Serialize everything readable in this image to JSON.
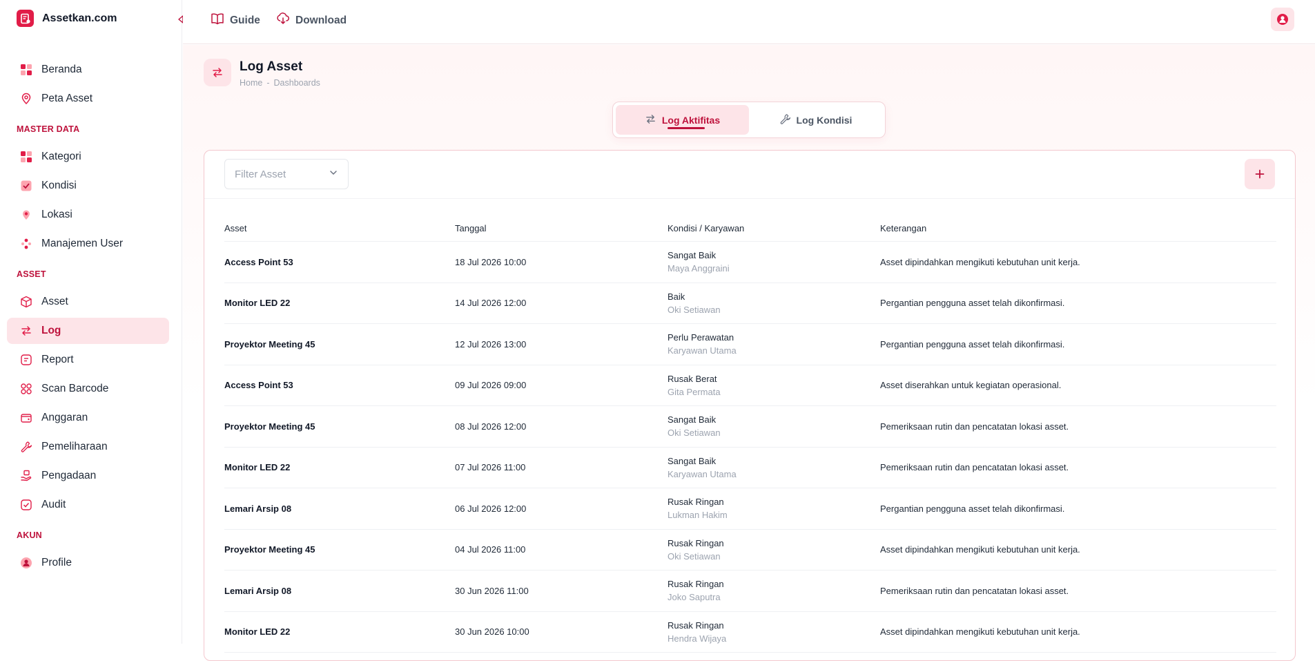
{
  "brand": {
    "name": "Assetkan.com"
  },
  "topbar": {
    "guide": "Guide",
    "download": "Download"
  },
  "sidebar": {
    "top_items": [
      {
        "label": "Beranda"
      },
      {
        "label": "Peta Asset"
      }
    ],
    "sections": [
      {
        "title": "MASTER DATA",
        "items": [
          "Kategori",
          "Kondisi",
          "Lokasi",
          "Manajemen User"
        ]
      },
      {
        "title": "ASSET",
        "items": [
          "Asset",
          "Log",
          "Report",
          "Scan Barcode",
          "Anggaran",
          "Pemeliharaan",
          "Pengadaan",
          "Audit"
        ]
      },
      {
        "title": "AKUN",
        "items": [
          "Profile"
        ]
      }
    ],
    "active_item": "Log"
  },
  "page": {
    "title": "Log Asset",
    "breadcrumb": [
      "Home",
      "-",
      "Dashboards"
    ]
  },
  "tabs": [
    {
      "label": "Log Aktifitas",
      "active": true
    },
    {
      "label": "Log Kondisi",
      "active": false
    }
  ],
  "filter": {
    "placeholder": "Filter Asset"
  },
  "table": {
    "columns": [
      "Asset",
      "Tanggal",
      "Kondisi / Karyawan",
      "Keterangan"
    ],
    "rows": [
      {
        "asset": "Access Point 53",
        "tanggal": "18 Jul 2026 10:00",
        "kondisi": "Sangat Baik",
        "karyawan": "Maya Anggraini",
        "keterangan": "Asset dipindahkan mengikuti kebutuhan unit kerja."
      },
      {
        "asset": "Monitor LED 22",
        "tanggal": "14 Jul 2026 12:00",
        "kondisi": "Baik",
        "karyawan": "Oki Setiawan",
        "keterangan": "Pergantian pengguna asset telah dikonfirmasi."
      },
      {
        "asset": "Proyektor Meeting 45",
        "tanggal": "12 Jul 2026 13:00",
        "kondisi": "Perlu Perawatan",
        "karyawan": "Karyawan Utama",
        "keterangan": "Pergantian pengguna asset telah dikonfirmasi."
      },
      {
        "asset": "Access Point 53",
        "tanggal": "09 Jul 2026 09:00",
        "kondisi": "Rusak Berat",
        "karyawan": "Gita Permata",
        "keterangan": "Asset diserahkan untuk kegiatan operasional."
      },
      {
        "asset": "Proyektor Meeting 45",
        "tanggal": "08 Jul 2026 12:00",
        "kondisi": "Sangat Baik",
        "karyawan": "Oki Setiawan",
        "keterangan": "Pemeriksaan rutin dan pencatatan lokasi asset."
      },
      {
        "asset": "Monitor LED 22",
        "tanggal": "07 Jul 2026 11:00",
        "kondisi": "Sangat Baik",
        "karyawan": "Karyawan Utama",
        "keterangan": "Pemeriksaan rutin dan pencatatan lokasi asset."
      },
      {
        "asset": "Lemari Arsip 08",
        "tanggal": "06 Jul 2026 12:00",
        "kondisi": "Rusak Ringan",
        "karyawan": "Lukman Hakim",
        "keterangan": "Pergantian pengguna asset telah dikonfirmasi."
      },
      {
        "asset": "Proyektor Meeting 45",
        "tanggal": "04 Jul 2026 11:00",
        "kondisi": "Rusak Ringan",
        "karyawan": "Oki Setiawan",
        "keterangan": "Asset dipindahkan mengikuti kebutuhan unit kerja."
      },
      {
        "asset": "Lemari Arsip 08",
        "tanggal": "30 Jun 2026 11:00",
        "kondisi": "Rusak Ringan",
        "karyawan": "Joko Saputra",
        "keterangan": "Pemeriksaan rutin dan pencatatan lokasi asset."
      },
      {
        "asset": "Monitor LED 22",
        "tanggal": "30 Jun 2026 10:00",
        "kondisi": "Rusak Ringan",
        "karyawan": "Hendra Wijaya",
        "keterangan": "Asset dipindahkan mengikuti kebutuhan unit kerja."
      }
    ]
  },
  "colors": {
    "accent": "#be123c",
    "accent_soft": "#fde4e8",
    "brand": "#e11d48"
  }
}
